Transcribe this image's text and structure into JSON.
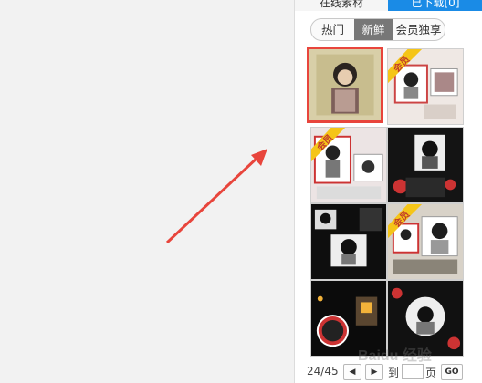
{
  "tabs": {
    "online": "在线素材",
    "downloaded": "已下载[0]"
  },
  "filters": {
    "hot": "热门",
    "new": "新鲜",
    "member": "会员独享",
    "active": "新鲜"
  },
  "thumbnails": [
    {
      "badge": "",
      "selected": true
    },
    {
      "badge": "会员",
      "selected": false
    },
    {
      "badge": "会员",
      "selected": false
    },
    {
      "badge": "",
      "selected": false
    },
    {
      "badge": "",
      "selected": false
    },
    {
      "badge": "会员",
      "selected": false
    },
    {
      "badge": "",
      "selected": false
    },
    {
      "badge": "",
      "selected": false
    }
  ],
  "pager": {
    "count": "24/45",
    "prev_icon": "◀",
    "next_icon": "▶",
    "to_label": "到",
    "page_value": "",
    "page_unit": "页",
    "go_label": "GO"
  },
  "watermark": "Baidu 经验",
  "colors": {
    "accent": "#1a8be6",
    "selection": "#e8453c",
    "arrow": "#e8453c",
    "badge": "#f5c518"
  },
  "icons": {
    "prev": "triangle-left-icon",
    "next": "triangle-right-icon",
    "arrow": "red-pointer-arrow"
  }
}
